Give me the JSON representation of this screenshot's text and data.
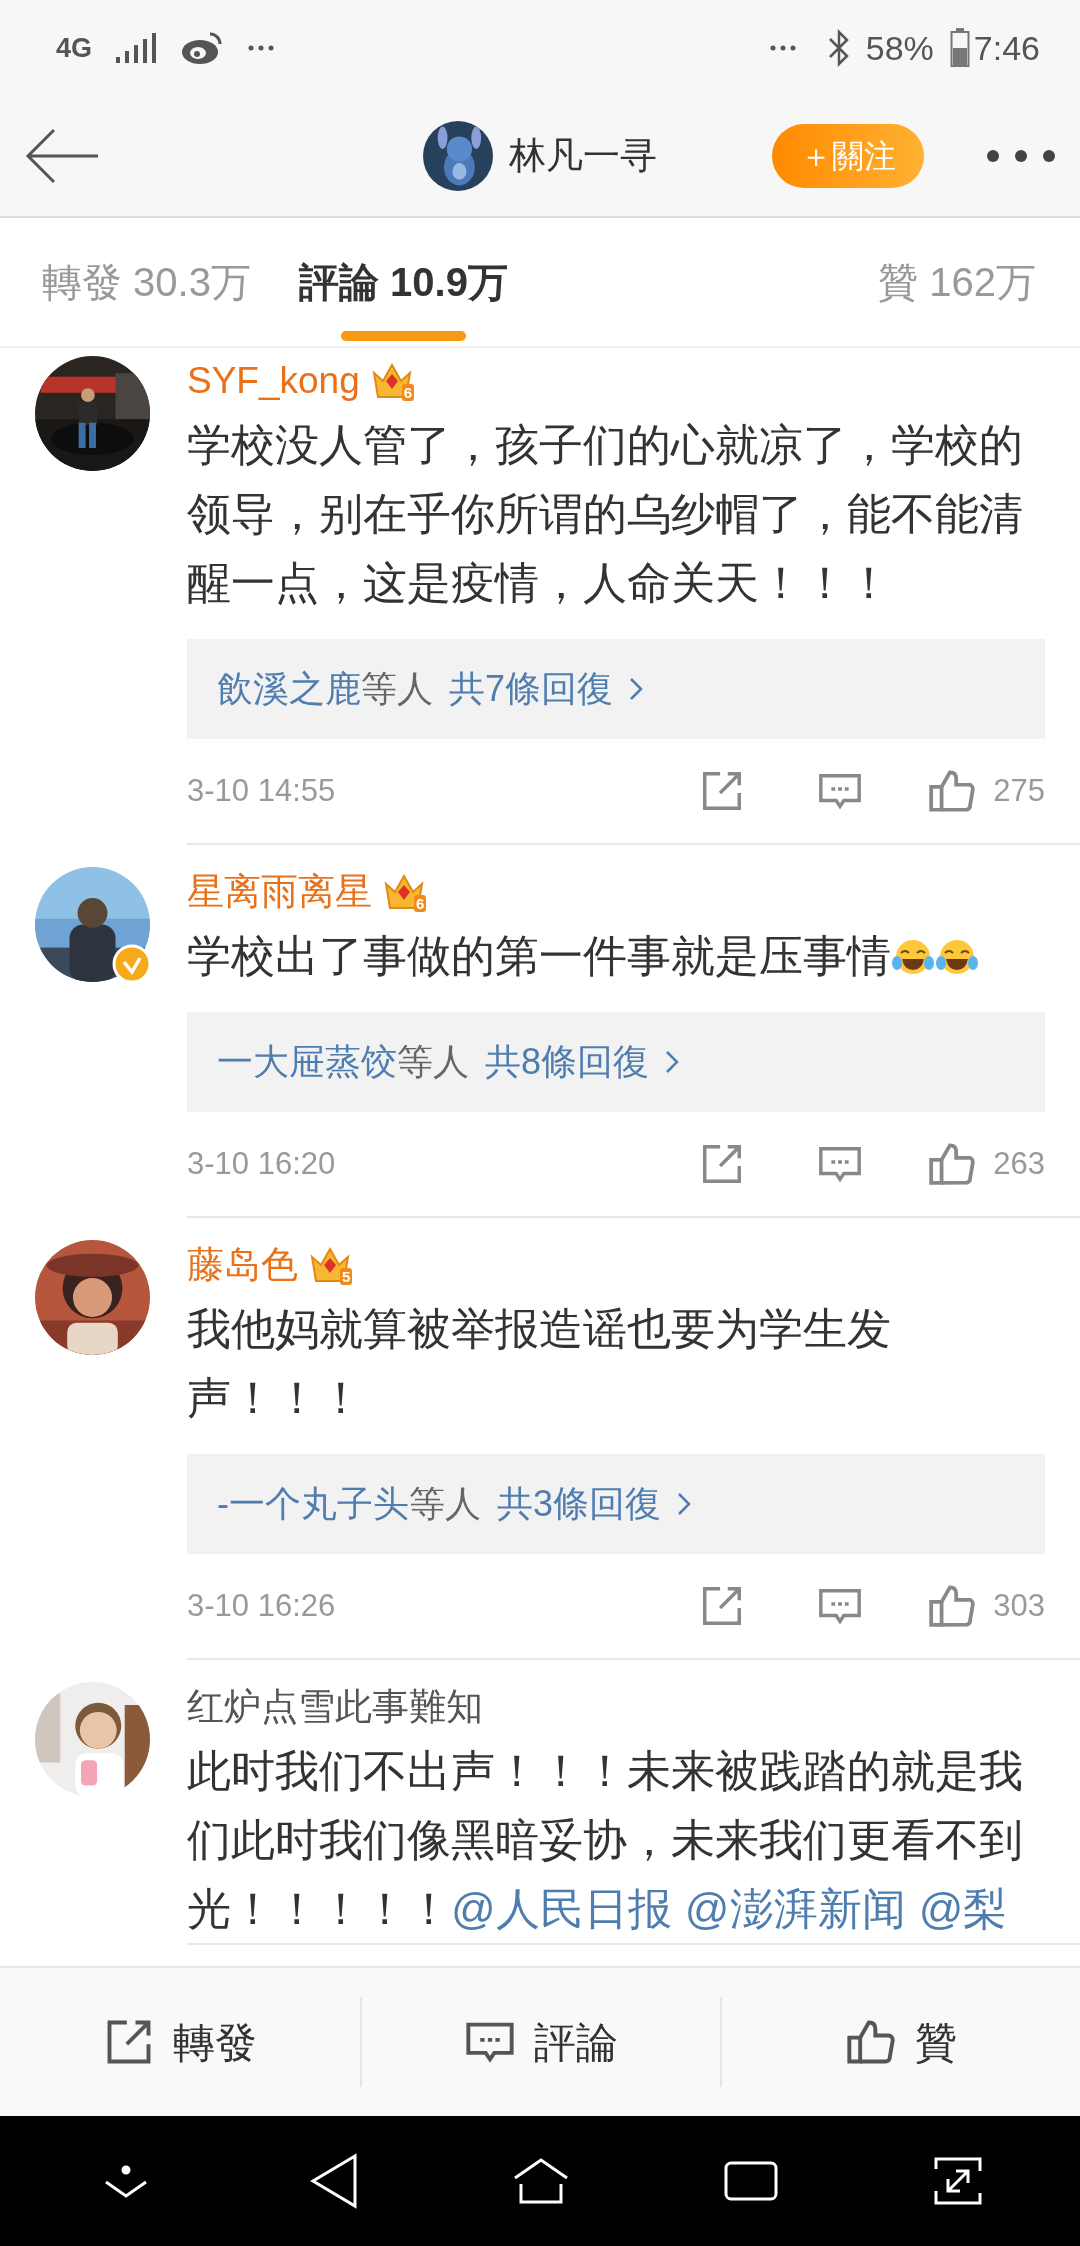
{
  "status_bar": {
    "network": "4G",
    "battery": "58%",
    "time": "7:46"
  },
  "header": {
    "title": "林凡一寻",
    "follow_button": "＋關注"
  },
  "tabs": [
    {
      "label": "轉發",
      "count": "30.3万",
      "selected": false
    },
    {
      "label": "評論",
      "count": "10.9万",
      "selected": true
    },
    {
      "label": "贊",
      "count": "162万",
      "selected": false
    }
  ],
  "comments": [
    {
      "author": "SYF_kong",
      "vip": true,
      "vip_level": "6",
      "verified": false,
      "body": [
        {
          "kind": "text",
          "text": "学校没人管了，孩子们的心就凉了，学校的领导，别在乎你所谓的乌纱帽了，能不能清醒一点，这是疫情，人命关天！！！"
        }
      ],
      "replies": {
        "names": "飲溪之鹿",
        "suffix": "等人",
        "link": "共7條回復"
      },
      "time": "3-10 14:55",
      "likes": "275"
    },
    {
      "author": "星离雨离星",
      "vip": true,
      "vip_level": "6",
      "verified": true,
      "body": [
        {
          "kind": "text",
          "text": "学校出了事做的第一件事就是压事情"
        },
        {
          "kind": "emoji"
        },
        {
          "kind": "emoji"
        }
      ],
      "replies": {
        "names": "一大屉蒸饺",
        "suffix": "等人",
        "link": "共8條回復"
      },
      "time": "3-10 16:20",
      "likes": "263"
    },
    {
      "author": "藤岛色",
      "vip": true,
      "vip_level": "5",
      "verified": false,
      "body": [
        {
          "kind": "text",
          "text": "我他妈就算被举报造谣也要为学生发声！！！"
        }
      ],
      "replies": {
        "names": "-一个丸子头",
        "suffix": "等人",
        "link": "共3條回復"
      },
      "time": "3-10 16:26",
      "likes": "303"
    },
    {
      "author": "红炉点雪此事難知",
      "vip": false,
      "verified": false,
      "body": [
        {
          "kind": "text",
          "text": "此时我们不出声！！！未来被践踏的就是我们此时我们像黑暗妥协，未来我们更看不到光！！！！！"
        },
        {
          "kind": "mention",
          "text": "@人民日报"
        },
        {
          "kind": "mention",
          "text": "@澎湃新闻"
        },
        {
          "kind": "mention",
          "text": "@梨"
        }
      ]
    }
  ],
  "actions": [
    {
      "kind": "repost",
      "label": "轉發"
    },
    {
      "kind": "comment",
      "label": "評論"
    },
    {
      "kind": "like",
      "label": "贊"
    }
  ]
}
